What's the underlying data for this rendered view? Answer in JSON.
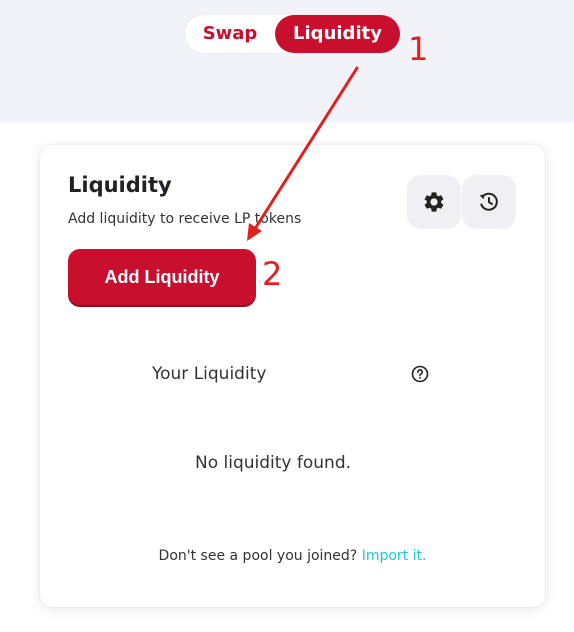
{
  "tabs": {
    "swap_label": "Swap",
    "liquidity_label": "Liquidity",
    "active": "Liquidity"
  },
  "card": {
    "title": "Liquidity",
    "subtitle": "Add liquidity to receive LP tokens",
    "add_button_label": "Add Liquidity",
    "your_liquidity_label": "Your Liquidity",
    "empty_message": "No liquidity found.",
    "import_prompt": "Don't see a pool you joined?",
    "import_link": "Import it."
  },
  "icons": {
    "settings": "gear-icon",
    "history": "history-icon",
    "help": "question-circle-icon"
  },
  "annotations": {
    "step_1": "1",
    "step_2": "2"
  },
  "colors": {
    "brand": "#c8102e",
    "link": "#1fc7d4",
    "annotation": "#e0201f",
    "header_background": "#f2f3f9"
  }
}
